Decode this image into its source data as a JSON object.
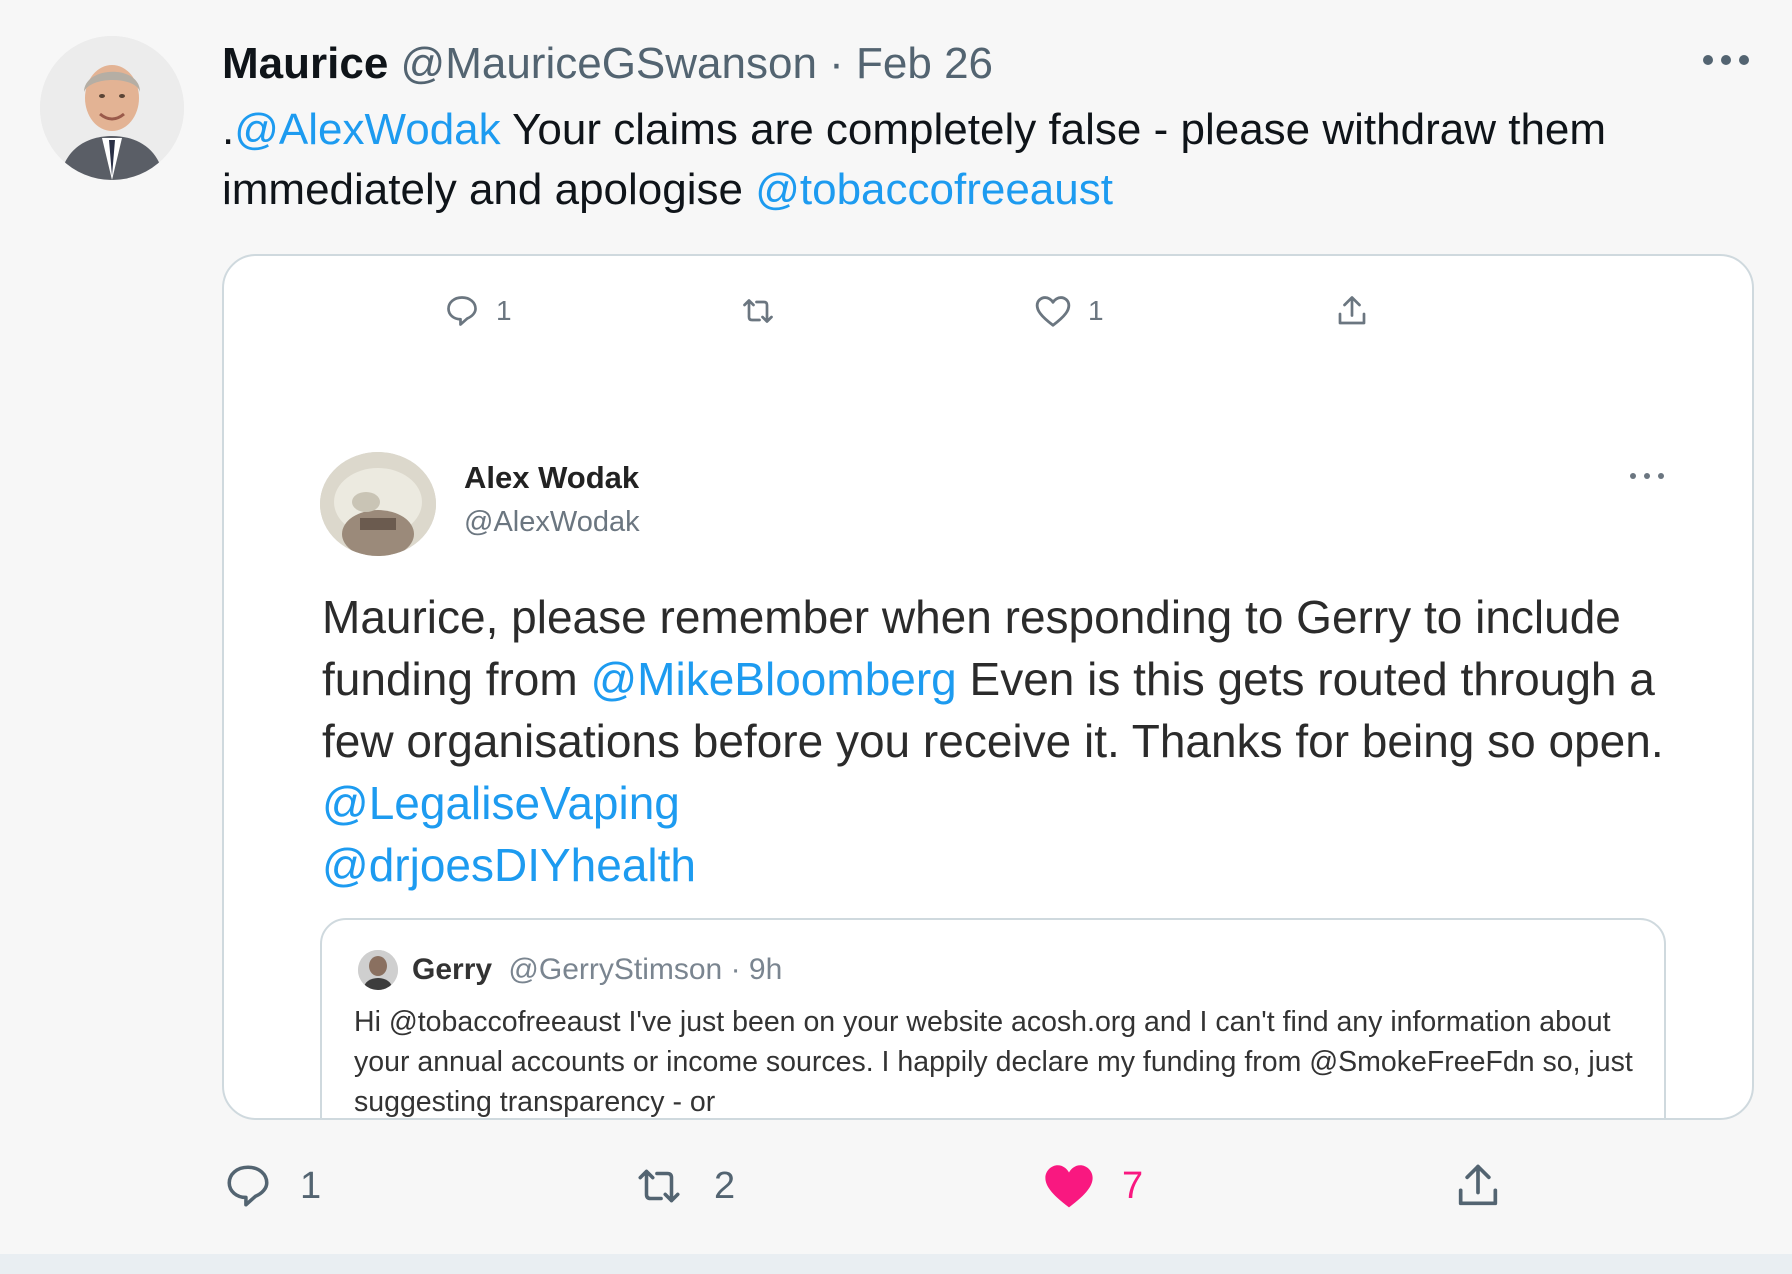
{
  "tweet": {
    "author_name": "Maurice",
    "author_handle": "@MauriceGSwanson",
    "separator": "·",
    "date": "Feb 26",
    "more_label": "More",
    "text_prefix": ".",
    "mention_1": "@AlexWodak",
    "text_body": " Your claims are completely false - please withdraw them immediately and apologise ",
    "mention_2": "@tobaccofreeaust"
  },
  "embedded_screenshot": {
    "actions": {
      "reply_count": "1",
      "retweet_count": "",
      "like_count": "1"
    },
    "author_name": "Alex Wodak",
    "author_handle": "@AlexWodak",
    "text_part_1": "Maurice, please remember when responding to Gerry to include funding from ",
    "mention_1": "@MikeBloomberg",
    "text_part_2": " Even is this gets routed through a few organisations before you receive it. Thanks for being so open. ",
    "mention_2": "@LegaliseVaping",
    "mention_3": "@drjoesDIYhealth",
    "quoted": {
      "author_name": "Gerry",
      "author_handle": "@GerryStimson · 9h",
      "text": "Hi @tobaccofreeaust I've just been on your website acosh.org and I can't find any information about your annual accounts or income sources. I happily declare my funding from @SmokeFreeFdn so, just suggesting transparency - or"
    }
  },
  "actions": {
    "reply_count": "1",
    "retweet_count": "2",
    "like_count": "7",
    "like_color": "#f91880",
    "icon_color": "#536471"
  },
  "colors": {
    "link": "#1d9bf0",
    "background": "#f7f7f7",
    "card_border": "#cfd9de"
  }
}
